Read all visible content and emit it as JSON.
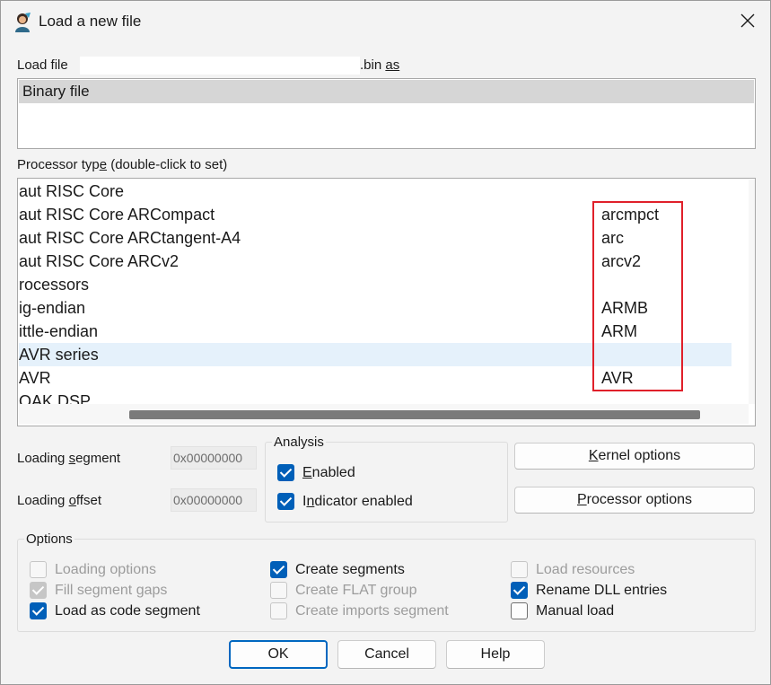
{
  "window": {
    "title": "Load a new file",
    "close_icon": "close-icon"
  },
  "load_file": {
    "label_prefix": "Load file",
    "label_suffix": ".bin",
    "label_as": "as",
    "types": [
      "Binary file"
    ],
    "selected_index": 0
  },
  "processor": {
    "label": "Processor type (double-click to set)",
    "rows": [
      {
        "name": "aut RISC Core",
        "short": ""
      },
      {
        "name": "aut RISC Core ARCompact",
        "short": "arcmpct"
      },
      {
        "name": "aut RISC Core ARCtangent-A4",
        "short": "arc"
      },
      {
        "name": "aut RISC Core ARCv2",
        "short": "arcv2"
      },
      {
        "name": "rocessors",
        "short": ""
      },
      {
        "name": "ig-endian",
        "short": "ARMB"
      },
      {
        "name": "ittle-endian",
        "short": "ARM"
      },
      {
        "name": "AVR series",
        "short": ""
      },
      {
        "name": "AVR",
        "short": "AVR"
      },
      {
        "name": "OAK DSP",
        "short": ""
      }
    ],
    "selected_index": 7
  },
  "loading": {
    "segment_label": "Loading segment",
    "segment_value": "0x00000000",
    "offset_label": "Loading offset",
    "offset_value": "0x00000000"
  },
  "analysis": {
    "title": "Analysis",
    "enabled_label": "Enabled",
    "enabled_checked": true,
    "indicator_label": "Indicator enabled",
    "indicator_checked": true
  },
  "buttons": {
    "kernel_options": "Kernel options",
    "processor_options": "Processor options",
    "ok": "OK",
    "cancel": "Cancel",
    "help": "Help"
  },
  "options": {
    "title": "Options",
    "col1": [
      {
        "label": "Loading options",
        "checked": false,
        "disabled": true
      },
      {
        "label": "Fill segment gaps",
        "checked": true,
        "disabled": true
      },
      {
        "label": "Load as code segment",
        "checked": true,
        "disabled": false
      }
    ],
    "col2": [
      {
        "label": "Create segments",
        "checked": true,
        "disabled": false
      },
      {
        "label": "Create FLAT group",
        "checked": false,
        "disabled": true
      },
      {
        "label": "Create imports segment",
        "checked": false,
        "disabled": true
      }
    ],
    "col3": [
      {
        "label": "Load resources",
        "checked": false,
        "disabled": true
      },
      {
        "label": "Rename DLL entries",
        "checked": true,
        "disabled": false
      },
      {
        "label": "Manual load",
        "checked": false,
        "disabled": false
      }
    ]
  }
}
